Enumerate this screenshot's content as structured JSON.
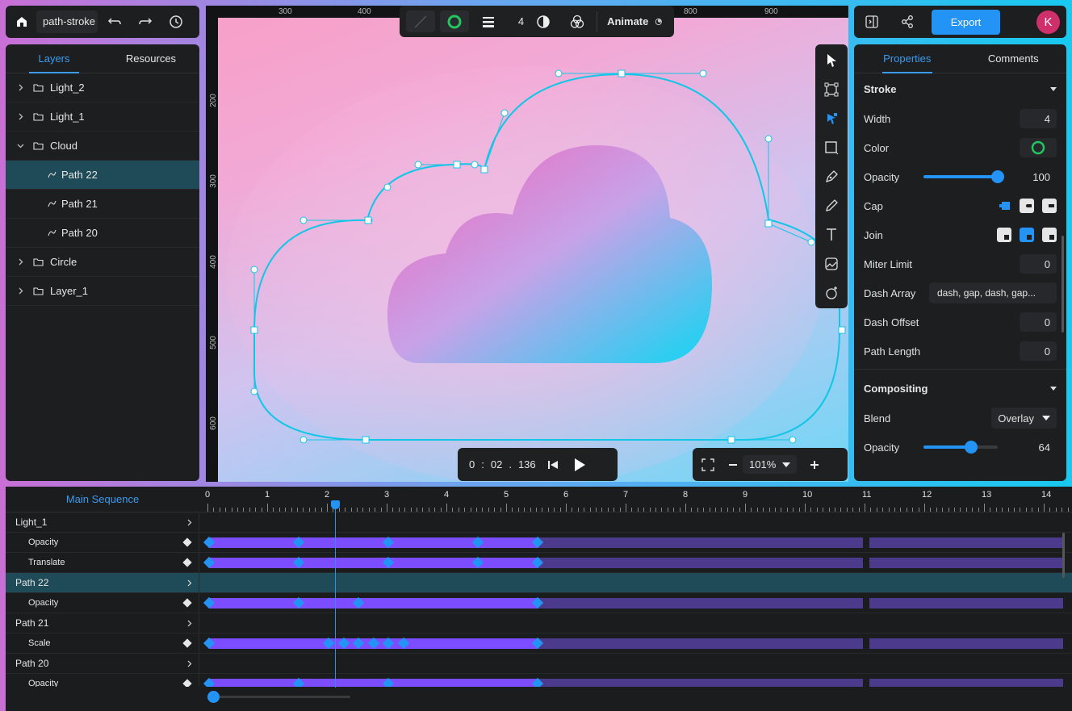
{
  "file": {
    "name": "path-stroke"
  },
  "toolbar": {
    "stroke_width": "4",
    "animate_label": "Animate",
    "export_label": "Export",
    "avatar_initial": "K"
  },
  "rulers": {
    "top": [
      "300",
      "400",
      "800",
      "900"
    ],
    "left": [
      "200",
      "300",
      "400",
      "500",
      "600"
    ]
  },
  "layers_panel": {
    "tabs": [
      "Layers",
      "Resources"
    ],
    "active_tab": "Layers",
    "items": [
      {
        "label": "Light_2",
        "type": "group",
        "expanded": false
      },
      {
        "label": "Light_1",
        "type": "group",
        "expanded": false
      },
      {
        "label": "Cloud",
        "type": "group",
        "expanded": true
      },
      {
        "label": "Path 22",
        "type": "path",
        "selected": true
      },
      {
        "label": "Path 21",
        "type": "path"
      },
      {
        "label": "Path 20",
        "type": "path"
      },
      {
        "label": "Circle",
        "type": "group",
        "expanded": false
      },
      {
        "label": "Layer_1",
        "type": "group",
        "expanded": false
      }
    ]
  },
  "properties_panel": {
    "tabs": [
      "Properties",
      "Comments"
    ],
    "active_tab": "Properties",
    "stroke": {
      "title": "Stroke",
      "width_label": "Width",
      "width": "4",
      "color_label": "Color",
      "color": "#22c55e",
      "opacity_label": "Opacity",
      "opacity": "100",
      "cap_label": "Cap",
      "join_label": "Join",
      "miter_label": "Miter Limit",
      "miter": "0",
      "dash_array_label": "Dash Array",
      "dash_array_placeholder": "dash, gap, dash, gap...",
      "dash_offset_label": "Dash Offset",
      "dash_offset": "0",
      "path_length_label": "Path Length",
      "path_length": "0"
    },
    "compositing": {
      "title": "Compositing",
      "blend_label": "Blend",
      "blend": "Overlay",
      "opacity_label": "Opacity",
      "opacity": "64"
    }
  },
  "playback": {
    "minutes": "0",
    "seconds": "02",
    "millis": "136"
  },
  "zoom": {
    "value": "101%"
  },
  "timeline": {
    "sequence_label": "Main Sequence",
    "ticks": [
      "0",
      "1",
      "2",
      "3",
      "4",
      "5",
      "6",
      "7",
      "8",
      "9",
      "10",
      "11",
      "12",
      "13",
      "14"
    ],
    "rows": [
      {
        "label": "Light_1",
        "kind": "group"
      },
      {
        "label": "Opacity",
        "kind": "prop",
        "keys": [
          0,
          1.5,
          3,
          4.5,
          5.5
        ]
      },
      {
        "label": "Translate",
        "kind": "prop",
        "keys": [
          0,
          1.5,
          3,
          4.5,
          5.5
        ]
      },
      {
        "label": "Path 22",
        "kind": "group",
        "selected": true
      },
      {
        "label": "Opacity",
        "kind": "prop",
        "keys": [
          0,
          1.5,
          2.5,
          5.5
        ]
      },
      {
        "label": "Path 21",
        "kind": "group"
      },
      {
        "label": "Scale",
        "kind": "prop",
        "keys": [
          0,
          2,
          2.25,
          2.5,
          2.75,
          3,
          3.25,
          5.5
        ]
      },
      {
        "label": "Path 20",
        "kind": "group"
      },
      {
        "label": "Opacity",
        "kind": "prop",
        "keys": [
          0,
          1.5,
          3,
          5.5
        ]
      }
    ],
    "playhead_time": 2.15,
    "duration": 14.3
  },
  "colors": {
    "accent": "#2393f5",
    "track": "#7c4dff",
    "track_dim": "#4c3a8c"
  }
}
